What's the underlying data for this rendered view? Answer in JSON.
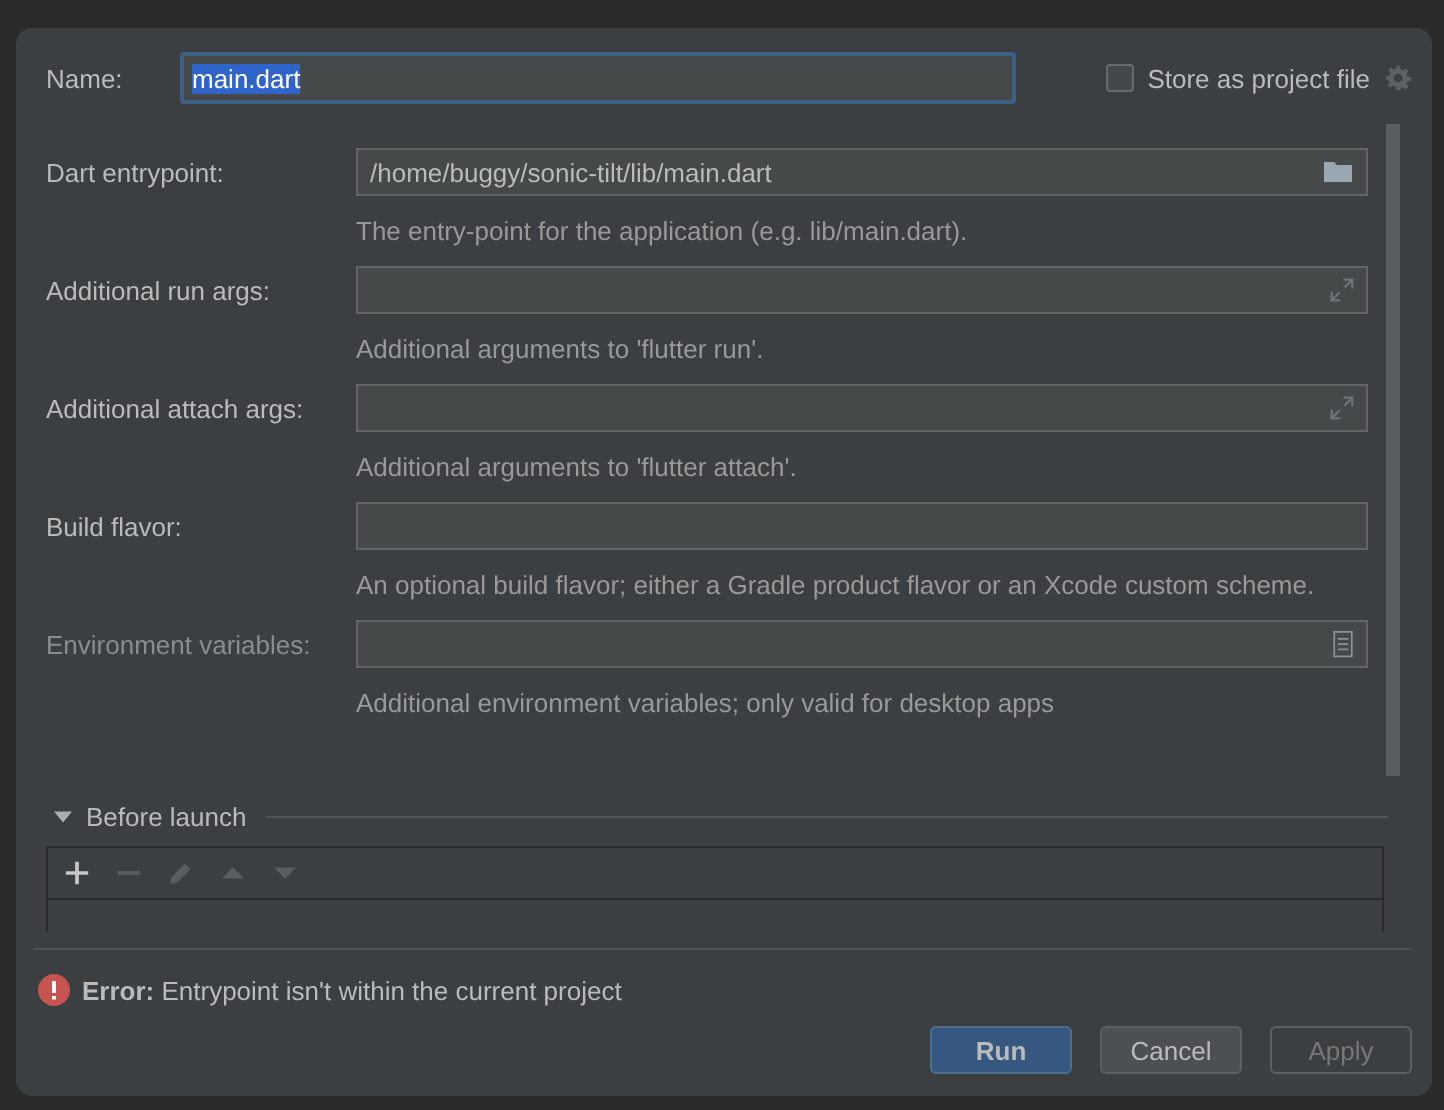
{
  "name_field": {
    "label": "Name:",
    "value": "main.dart",
    "text_selected": true
  },
  "store_as_project_file": {
    "label": "Store as project file",
    "checked": false
  },
  "fields": [
    {
      "label": "Dart entrypoint:",
      "value": "/home/buggy/sonic-tilt/lib/main.dart",
      "kind": "file",
      "hint": "The entry-point for the application (e.g. lib/main.dart).",
      "disabled": false
    },
    {
      "label": "Additional run args:",
      "kind": "expand",
      "hint": "Additional arguments to 'flutter run'.",
      "disabled": false
    },
    {
      "label": "Additional attach args:",
      "kind": "expand",
      "hint": "Additional arguments to 'flutter attach'.",
      "disabled": false
    },
    {
      "label": "Build flavor:",
      "kind": "plain",
      "hint": "An optional build flavor; either a Gradle product flavor or an Xcode custom scheme.",
      "disabled": false
    },
    {
      "label": "Environment variables:",
      "kind": "env",
      "hint": "Additional environment variables; only valid for desktop apps",
      "disabled": true
    }
  ],
  "before_launch": {
    "title": "Before launch",
    "expanded": true,
    "tools": [
      {
        "kind": "add",
        "disabled": false
      },
      {
        "kind": "remove",
        "disabled": true
      },
      {
        "kind": "edit",
        "disabled": true
      },
      {
        "kind": "up",
        "disabled": true
      },
      {
        "kind": "down",
        "disabled": true
      }
    ]
  },
  "error": {
    "label": "Error:",
    "message": "Entrypoint isn't within the current project"
  },
  "buttons": [
    {
      "label": "Run",
      "kind": "primary",
      "disabled": false
    },
    {
      "label": "Cancel",
      "kind": "normal",
      "disabled": false
    },
    {
      "label": "Apply",
      "kind": "normal",
      "disabled": true
    }
  ]
}
